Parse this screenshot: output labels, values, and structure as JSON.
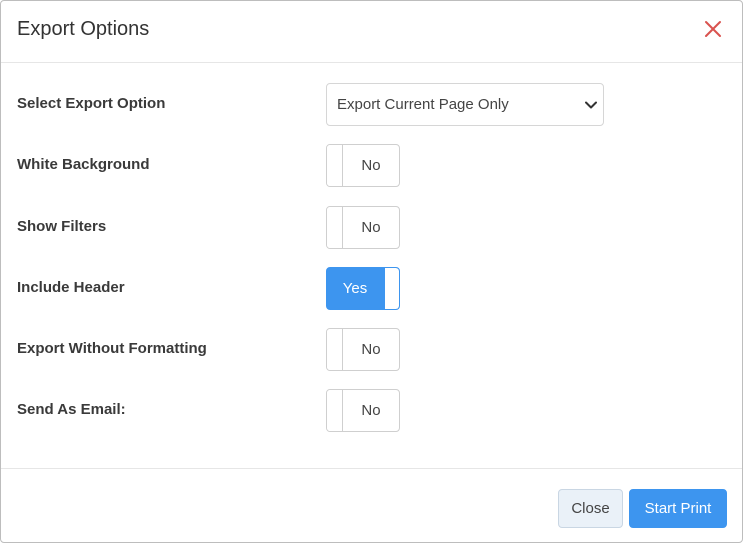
{
  "dialog": {
    "title": "Export Options",
    "close_icon": "close-x-icon",
    "accent_color": "#3d95ef",
    "close_icon_color": "#d9534f"
  },
  "form": {
    "export_option": {
      "label": "Select Export Option",
      "selected_value": "Export Current Page Only",
      "icon": "chevron-down-icon"
    },
    "white_background": {
      "label": "White Background",
      "state": "No",
      "on": false
    },
    "show_filters": {
      "label": "Show Filters",
      "state": "No",
      "on": false
    },
    "include_header": {
      "label": "Include Header",
      "state": "Yes",
      "on": true
    },
    "export_without_formatting": {
      "label": "Export Without Formatting",
      "state": "No",
      "on": false
    },
    "send_as_email": {
      "label": "Send As Email:",
      "state": "No",
      "on": false
    }
  },
  "footer": {
    "close_label": "Close",
    "start_print_label": "Start Print"
  }
}
